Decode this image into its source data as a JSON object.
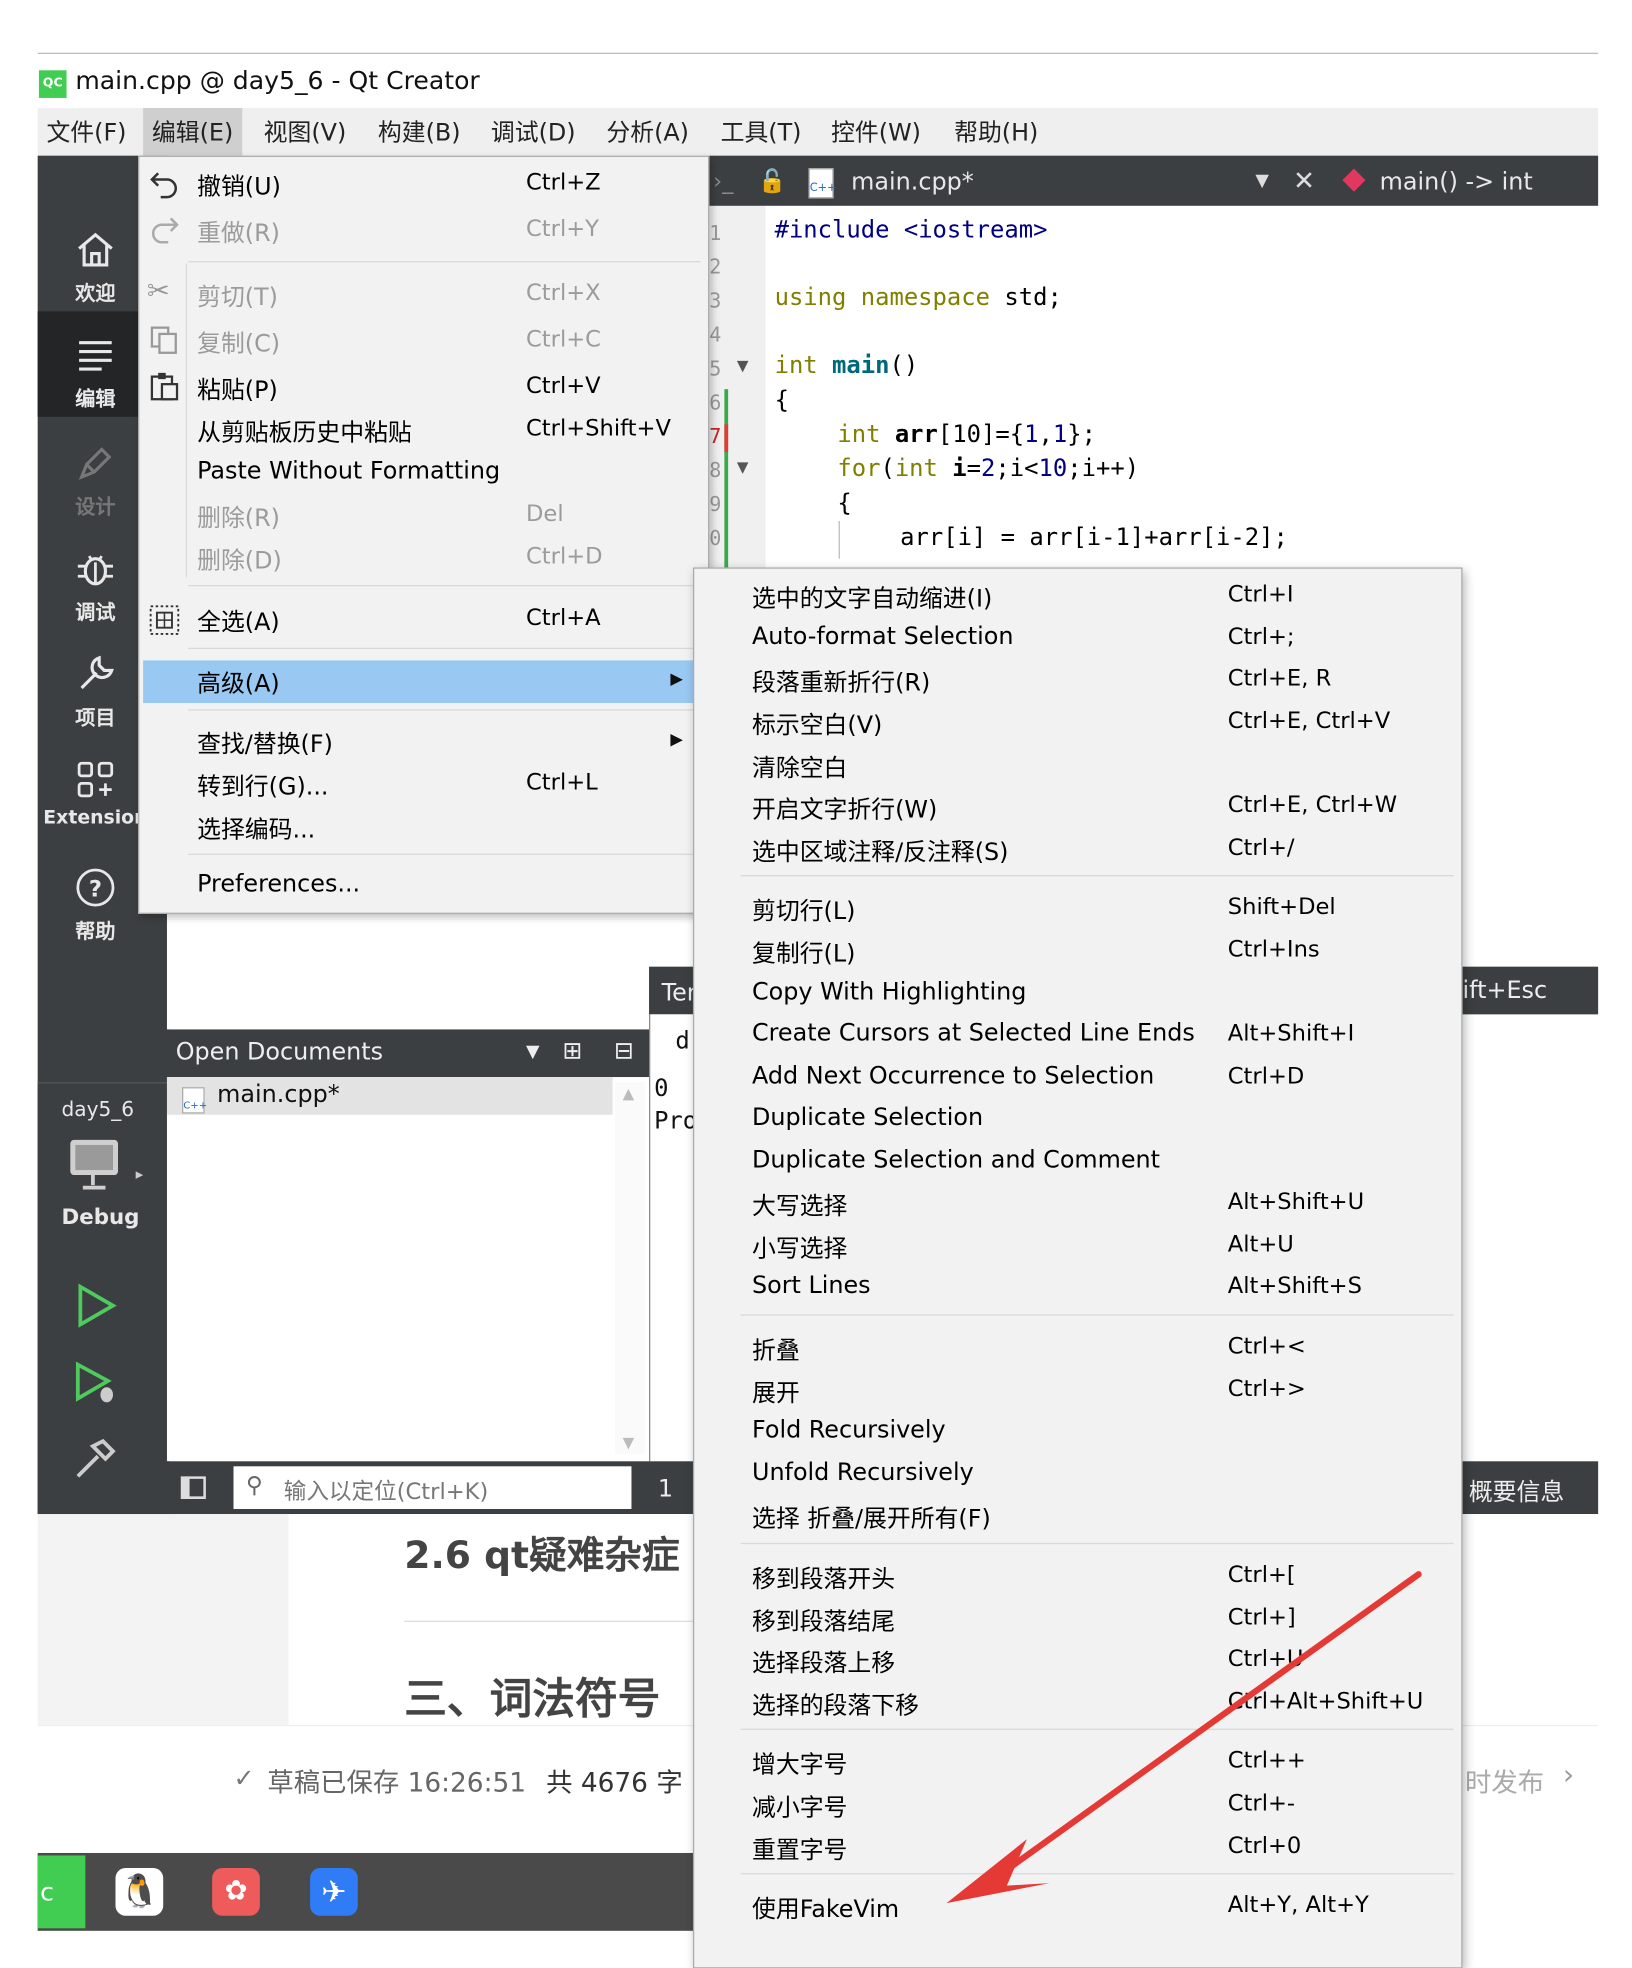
{
  "window": {
    "logo": "QC",
    "title": "main.cpp @ day5_6 - Qt Creator"
  },
  "menubar": [
    "文件(F)",
    "编辑(E)",
    "视图(V)",
    "构建(B)",
    "调试(D)",
    "分析(A)",
    "工具(T)",
    "控件(W)",
    "帮助(H)"
  ],
  "modes": {
    "welcome": "欢迎",
    "edit": "编辑",
    "design": "设计",
    "debug": "调试",
    "project": "项目",
    "extension": "Extension",
    "help": "帮助"
  },
  "kit": {
    "project": "day5_6",
    "config": "Debug"
  },
  "editor": {
    "file": "main.cpp*",
    "func": "main() -> int",
    "lines": [
      "1",
      "2",
      "3",
      "4",
      "5",
      "6",
      "7",
      "8",
      "9",
      "0"
    ],
    "code": {
      "l1a": "#include",
      "l1b": " <iostream>",
      "l3a": "using namespace",
      "l3b": " std;",
      "l5a": "int",
      "l5b": "main",
      "l5c": "()",
      "l6": "{",
      "l7a": "int",
      "l7b": "arr",
      "l7c": "[10]={",
      "l7d": "1",
      "l7e": ",",
      "l7f": "1",
      "l7g": "};",
      "l8a": "for",
      "l8b": "(",
      "l8c": "int",
      "l8d": "i",
      "l8e": "=",
      "l8f": "2",
      "l8g": ";i<",
      "l8h": "10",
      "l8i": ";i++)",
      "l9": "{",
      "l10": "arr[i] = arr[i-1]+arr[i-2];"
    }
  },
  "editmenu": [
    {
      "label": "撤销(U)",
      "shortcut": "Ctrl+Z",
      "disabled": false
    },
    {
      "label": "重做(R)",
      "shortcut": "Ctrl+Y",
      "disabled": true
    },
    {
      "label": "剪切(T)",
      "shortcut": "Ctrl+X",
      "disabled": true
    },
    {
      "label": "复制(C)",
      "shortcut": "Ctrl+C",
      "disabled": true
    },
    {
      "label": "粘贴(P)",
      "shortcut": "Ctrl+V",
      "disabled": false
    },
    {
      "label": "从剪贴板历史中粘贴",
      "shortcut": "Ctrl+Shift+V",
      "disabled": false
    },
    {
      "label": "Paste Without Formatting",
      "shortcut": "",
      "disabled": false
    },
    {
      "label": "删除(R)",
      "shortcut": "Del",
      "disabled": true
    },
    {
      "label": "删除(D)",
      "shortcut": "Ctrl+D",
      "disabled": true
    },
    {
      "label": "全选(A)",
      "shortcut": "Ctrl+A",
      "disabled": false
    },
    {
      "label": "高级(A)",
      "shortcut": "",
      "disabled": false
    },
    {
      "label": "查找/替换(F)",
      "shortcut": "",
      "disabled": false
    },
    {
      "label": "转到行(G)...",
      "shortcut": "Ctrl+L",
      "disabled": false
    },
    {
      "label": "选择编码...",
      "shortcut": "",
      "disabled": false
    },
    {
      "label": "Preferences...",
      "shortcut": "",
      "disabled": false
    }
  ],
  "submenu": [
    {
      "label": "选中的文字自动缩进(I)",
      "shortcut": "Ctrl+I",
      "disabled": false
    },
    {
      "label": "Auto-format Selection",
      "shortcut": "Ctrl+;",
      "disabled": false
    },
    {
      "label": "段落重新折行(R)",
      "shortcut": "Ctrl+E, R",
      "disabled": false
    },
    {
      "label": "标示空白(V)",
      "shortcut": "Ctrl+E, Ctrl+V",
      "disabled": false
    },
    {
      "label": "清除空白",
      "shortcut": "",
      "disabled": false
    },
    {
      "label": "开启文字折行(W)",
      "shortcut": "Ctrl+E, Ctrl+W",
      "disabled": false
    },
    {
      "label": "选中区域注释/反注释(S)",
      "shortcut": "Ctrl+/",
      "disabled": false
    },
    {
      "label": "剪切行(L)",
      "shortcut": "Shift+Del",
      "disabled": false
    },
    {
      "label": "复制行(L)",
      "shortcut": "Ctrl+Ins",
      "disabled": false
    },
    {
      "label": "Copy With Highlighting",
      "shortcut": "",
      "disabled": true
    },
    {
      "label": "Create Cursors at Selected Line Ends",
      "shortcut": "Alt+Shift+I",
      "disabled": false
    },
    {
      "label": "Add Next Occurrence to Selection",
      "shortcut": "Ctrl+D",
      "disabled": false
    },
    {
      "label": "Duplicate Selection",
      "shortcut": "",
      "disabled": false
    },
    {
      "label": "Duplicate Selection and Comment",
      "shortcut": "",
      "disabled": false
    },
    {
      "label": "大写选择",
      "shortcut": "Alt+Shift+U",
      "disabled": false
    },
    {
      "label": "小写选择",
      "shortcut": "Alt+U",
      "disabled": false
    },
    {
      "label": "Sort Lines",
      "shortcut": "Alt+Shift+S",
      "disabled": false
    },
    {
      "label": "折叠",
      "shortcut": "Ctrl+<",
      "disabled": false
    },
    {
      "label": "展开",
      "shortcut": "Ctrl+>",
      "disabled": false
    },
    {
      "label": "Fold Recursively",
      "shortcut": "",
      "disabled": false
    },
    {
      "label": "Unfold Recursively",
      "shortcut": "",
      "disabled": false
    },
    {
      "label": "选择 折叠/展开所有(F)",
      "shortcut": "",
      "disabled": false
    },
    {
      "label": "移到段落开头",
      "shortcut": "Ctrl+[",
      "disabled": false
    },
    {
      "label": "移到段落结尾",
      "shortcut": "Ctrl+]",
      "disabled": false
    },
    {
      "label": "选择段落上移",
      "shortcut": "Ctrl+U",
      "disabled": false
    },
    {
      "label": "选择的段落下移",
      "shortcut": "Ctrl+Alt+Shift+U",
      "disabled": false
    },
    {
      "label": "增大字号",
      "shortcut": "Ctrl++",
      "disabled": false
    },
    {
      "label": "减小字号",
      "shortcut": "Ctrl+-",
      "disabled": false
    },
    {
      "label": "重置字号",
      "shortcut": "Ctrl+0",
      "disabled": false
    },
    {
      "label": "使用FakeVim",
      "shortcut": "Alt+Y, Alt+Y",
      "disabled": false
    }
  ],
  "panels": {
    "open_documents": "Open Documents",
    "doc_item": "main.cpp*",
    "terminal_tab": "Ter",
    "term_lines": [
      "d",
      "0",
      "Pro"
    ],
    "right_tab": "ift+Esc",
    "search_placeholder": "输入以定位(Ctrl+K)",
    "status_num": "1",
    "status_right": "概要信息"
  },
  "blog": {
    "heading1": "2.6 qt疑难杂症",
    "heading2": "三、词法符号",
    "draft": "草稿已保存 16:26:51",
    "count": "共 4676 字",
    "publish": "时发布"
  },
  "colors": {
    "highlight": "#99c9f3",
    "dark_panel": "#3c3f41",
    "arrow": "#e53935"
  }
}
